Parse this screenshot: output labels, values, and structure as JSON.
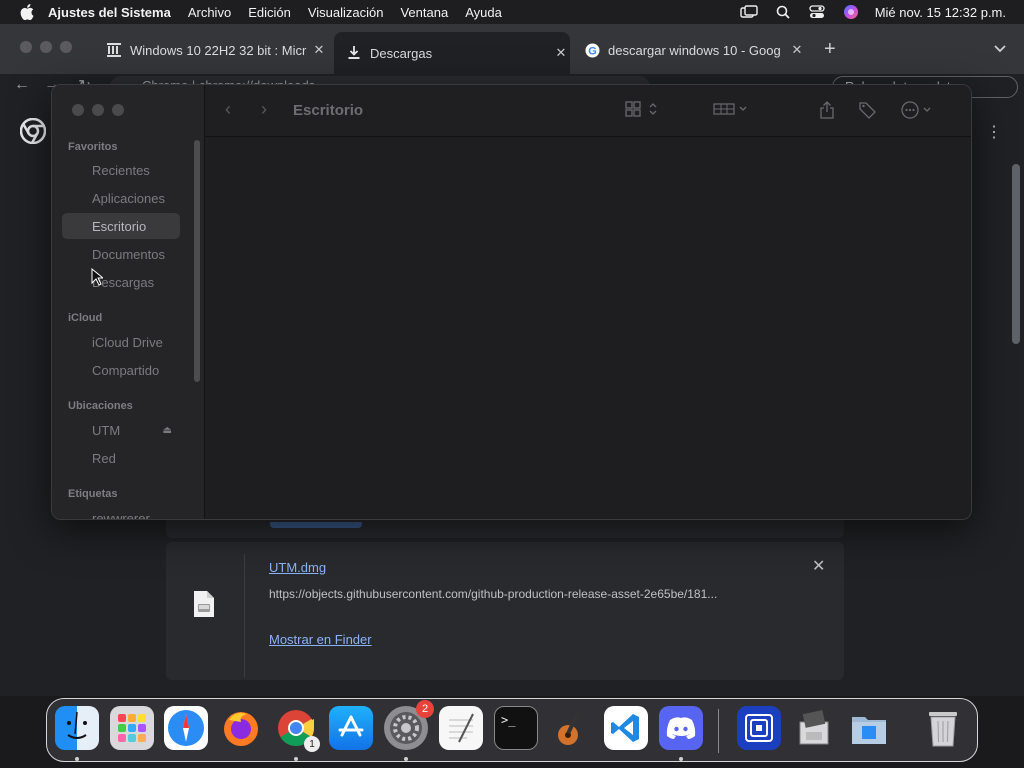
{
  "menubar": {
    "app_name": "Ajustes del Sistema",
    "items": [
      "Archivo",
      "Edición",
      "Visualización",
      "Ventana",
      "Ayuda"
    ],
    "clock": "Mié nov. 15  12:32 p.m.",
    "status_icons": [
      "display-mirror-icon",
      "spotlight-icon",
      "control-center-icon",
      "siri-icon"
    ]
  },
  "browser": {
    "tabs": [
      {
        "title": "Windows 10 22H2 32 bit : Micr",
        "icon": "archive-org-icon"
      },
      {
        "title": "Descargas",
        "icon": "download-icon"
      },
      {
        "title": "descargar windows 10 - Goog",
        "icon": "google-icon"
      }
    ],
    "active_tab": 1,
    "omnibox": "Chrome  |  chrome://downloads",
    "update_button": "Relaunch to update",
    "colors": {
      "link": "#8ab4f8",
      "page_bg": "#202124"
    }
  },
  "downloads": {
    "item": {
      "file_name": "UTM.dmg",
      "url": "https://objects.githubusercontent.com/github-production-release-asset-2e65be/181...",
      "show_in_finder": "Mostrar en Finder"
    }
  },
  "finder": {
    "current_folder": "Escritorio",
    "sections": [
      {
        "heading": "Favoritos",
        "items": [
          "Recientes",
          "Aplicaciones",
          "Escritorio",
          "Documentos",
          "Descargas"
        ]
      },
      {
        "heading": "iCloud",
        "items": [
          "iCloud Drive",
          "Compartido"
        ]
      },
      {
        "heading": "Ubicaciones",
        "items": [
          "UTM",
          "Red"
        ]
      },
      {
        "heading": "Etiquetas",
        "items": [
          "rewwrerer"
        ]
      }
    ],
    "selected_item": "Escritorio"
  },
  "dock": {
    "apps": [
      {
        "name": "Finder",
        "running": true
      },
      {
        "name": "Launchpad",
        "running": false
      },
      {
        "name": "Safari",
        "running": false
      },
      {
        "name": "Firefox",
        "running": false
      },
      {
        "name": "Google Chrome",
        "running": true,
        "badge": "1"
      },
      {
        "name": "App Store",
        "running": false
      },
      {
        "name": "Ajustes del Sistema",
        "running": true,
        "badge": "2"
      },
      {
        "name": "TextEdit",
        "running": false
      },
      {
        "name": "Terminal",
        "running": false
      },
      {
        "name": "GarageBand",
        "running": false
      },
      {
        "name": "Visual Studio Code",
        "running": false
      },
      {
        "name": "Discord",
        "running": true
      },
      {
        "name": "UTM",
        "running": false
      },
      {
        "name": "Instalador",
        "running": false
      },
      {
        "name": "Finder carpeta",
        "running": false
      },
      {
        "name": "Papelera",
        "running": false
      }
    ]
  }
}
